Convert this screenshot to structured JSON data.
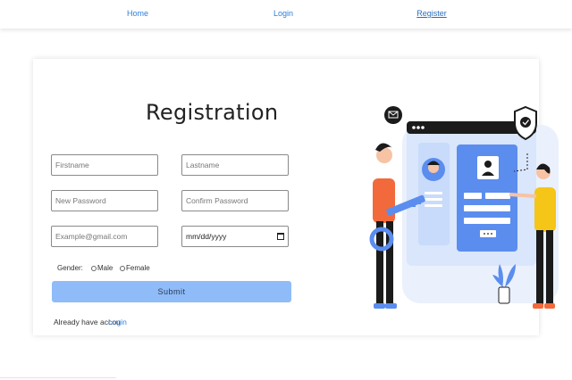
{
  "nav": {
    "home": "Home",
    "login": "Login",
    "register": "Register"
  },
  "form": {
    "title": "Registration",
    "firstname_placeholder": "Firstname",
    "lastname_placeholder": "Lastname",
    "new_password_placeholder": "New Password",
    "confirm_password_placeholder": "Confirm Password",
    "email_placeholder": "Example@gmail.com",
    "date_placeholder": "mm/dd/yyyy",
    "gender_label": "Gender:",
    "gender_options": [
      "Male",
      "Female"
    ],
    "submit_label": "Submit",
    "already_text": "Already have accou",
    "login_link": "Login"
  },
  "colors": {
    "link": "#2f7fd8",
    "submit_bg": "#8fbcf8",
    "illustration_blue": "#5b8def",
    "illustration_orange": "#f26a3c",
    "illustration_yellow": "#f5c518"
  }
}
